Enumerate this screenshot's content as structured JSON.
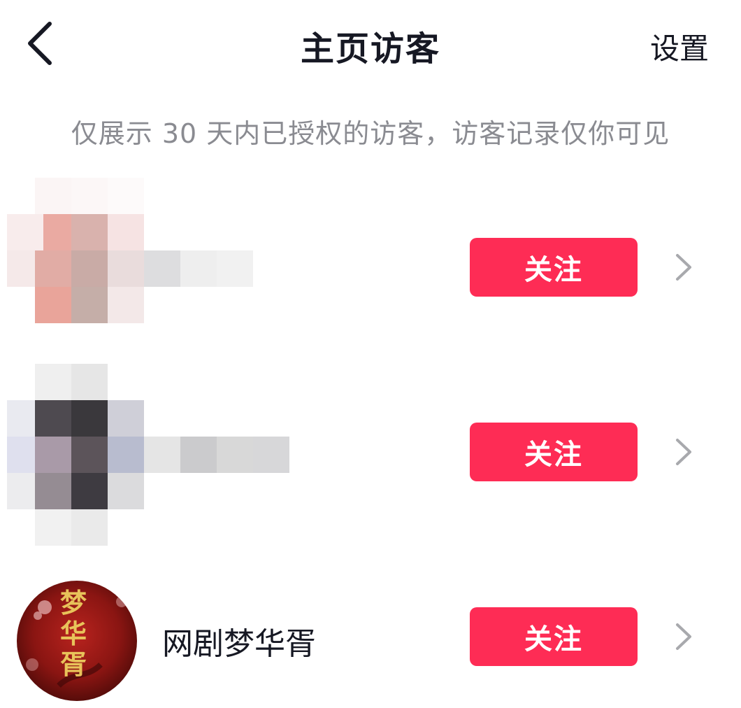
{
  "header": {
    "title": "主页访客",
    "settings_label": "设置"
  },
  "notice": {
    "text": "仅展示 30 天内已授权的访客，访客记录仅你可见"
  },
  "visitors": [
    {
      "name": "",
      "follow_label": "关注"
    },
    {
      "name": "",
      "follow_label": "关注"
    },
    {
      "name": "网剧梦华胥",
      "follow_label": "关注",
      "avatar_text": "梦华胥"
    }
  ],
  "colors": {
    "accent": "#fe2c55",
    "text_primary": "#161823",
    "text_secondary": "#8a8b91",
    "chevron": "#a8a9ad"
  },
  "icons": {
    "back": "chevron-left-icon",
    "row_arrow": "chevron-right-icon"
  }
}
